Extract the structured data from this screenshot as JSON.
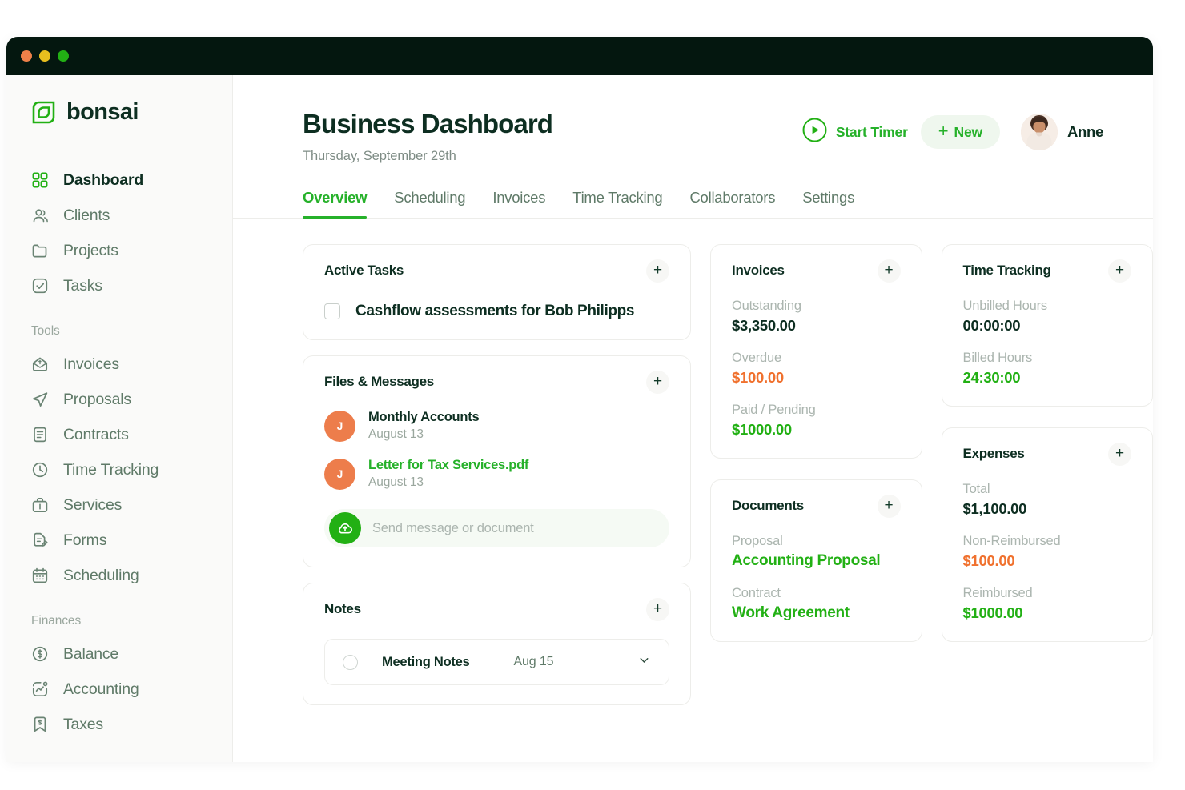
{
  "window": {
    "traffic_lights": [
      "close",
      "minimize",
      "zoom"
    ]
  },
  "brand": {
    "name": "bonsai",
    "logo_icon": "bonsai-square-spiral-logo",
    "primary_green": "#22B014",
    "accent_green": "#26B12A",
    "dark_green": "#0D2E21",
    "orange": "#F0712E",
    "avatar_orange": "#ED7D4B",
    "titlebar_bg": "#04170F"
  },
  "sidebar": {
    "primary_items": [
      {
        "label": "Dashboard",
        "icon": "grid-icon",
        "active": true
      },
      {
        "label": "Clients",
        "icon": "users-icon",
        "active": false
      },
      {
        "label": "Projects",
        "icon": "folder-icon",
        "active": false
      },
      {
        "label": "Tasks",
        "icon": "checkbox-square-icon",
        "active": false
      }
    ],
    "sections": [
      {
        "title": "Tools",
        "items": [
          {
            "label": "Invoices",
            "icon": "invoice-envelope-icon"
          },
          {
            "label": "Proposals",
            "icon": "paper-plane-icon"
          },
          {
            "label": "Contracts",
            "icon": "document-lines-icon"
          },
          {
            "label": "Time Tracking",
            "icon": "clock-icon"
          },
          {
            "label": "Services",
            "icon": "briefcase-icon"
          },
          {
            "label": "Forms",
            "icon": "document-pencil-icon"
          },
          {
            "label": "Scheduling",
            "icon": "calendar-icon"
          }
        ]
      },
      {
        "title": "Finances",
        "items": [
          {
            "label": "Balance",
            "icon": "dollar-circle-icon"
          },
          {
            "label": "Accounting",
            "icon": "chart-square-icon"
          },
          {
            "label": "Taxes",
            "icon": "bookmark-dollar-icon"
          }
        ]
      }
    ]
  },
  "header": {
    "title": "Business Dashboard",
    "date": "Thursday, September 29th",
    "start_timer_label": "Start Timer",
    "start_timer_icon": "play-circle-icon",
    "new_button_label": "New",
    "new_button_icon": "plus-icon",
    "user_name": "Anne",
    "avatar_icon": "user-photo-avatar"
  },
  "tabs": [
    {
      "label": "Overview",
      "active": true
    },
    {
      "label": "Scheduling",
      "active": false
    },
    {
      "label": "Invoices",
      "active": false
    },
    {
      "label": "Time Tracking",
      "active": false
    },
    {
      "label": "Collaborators",
      "active": false
    },
    {
      "label": "Settings",
      "active": false
    }
  ],
  "cards": {
    "active_tasks": {
      "title": "Active Tasks",
      "add_icon": "plus-icon",
      "tasks": [
        {
          "label": "Cashflow assessments for Bob Philipps",
          "checked": false
        }
      ]
    },
    "files_messages": {
      "title": "Files & Messages",
      "add_icon": "plus-icon",
      "items": [
        {
          "initial": "J",
          "name": "Monthly Accounts",
          "date": "August 13",
          "is_link": false
        },
        {
          "initial": "J",
          "name": "Letter for Tax Services.pdf",
          "date": "August 13",
          "is_link": true
        }
      ],
      "composer": {
        "placeholder": "Send message or document",
        "value": "",
        "upload_icon": "cloud-upload-icon"
      }
    },
    "notes": {
      "title": "Notes",
      "add_icon": "plus-icon",
      "items": [
        {
          "title": "Meeting Notes",
          "date": "Aug 15",
          "chevron_icon": "chevron-down-icon"
        }
      ]
    },
    "invoices": {
      "title": "Invoices",
      "add_icon": "plus-icon",
      "stats": [
        {
          "label": "Outstanding",
          "value": "$3,350.00",
          "tone": "dark"
        },
        {
          "label": "Overdue",
          "value": "$100.00",
          "tone": "orange"
        },
        {
          "label": "Paid / Pending",
          "value": "$1000.00",
          "tone": "green"
        }
      ]
    },
    "documents": {
      "title": "Documents",
      "add_icon": "plus-icon",
      "stats": [
        {
          "label": "Proposal",
          "value": "Accounting Proposal",
          "tone": "link"
        },
        {
          "label": "Contract",
          "value": "Work Agreement",
          "tone": "link"
        }
      ]
    },
    "time_tracking": {
      "title": "Time Tracking",
      "add_icon": "plus-icon",
      "stats": [
        {
          "label": "Unbilled Hours",
          "value": "00:00:00",
          "tone": "dark"
        },
        {
          "label": "Billed Hours",
          "value": "24:30:00",
          "tone": "green"
        }
      ]
    },
    "expenses": {
      "title": "Expenses",
      "add_icon": "plus-icon",
      "stats": [
        {
          "label": "Total",
          "value": "$1,100.00",
          "tone": "dark"
        },
        {
          "label": "Non-Reimbursed",
          "value": "$100.00",
          "tone": "orange"
        },
        {
          "label": "Reimbursed",
          "value": "$1000.00",
          "tone": "green"
        }
      ]
    }
  }
}
